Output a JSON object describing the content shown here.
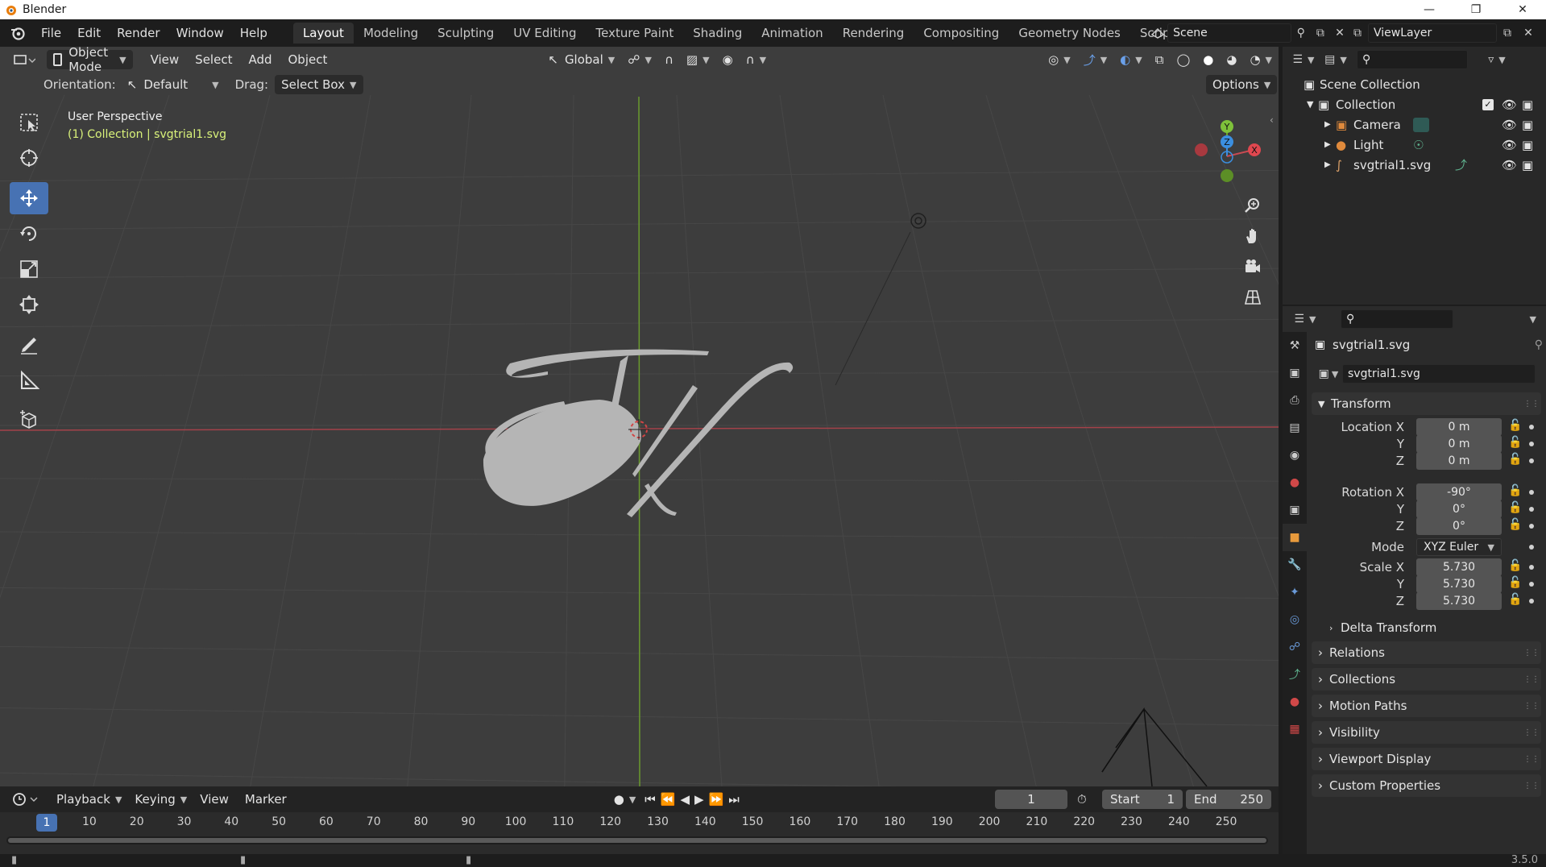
{
  "window": {
    "title": "Blender",
    "version": "3.5.0"
  },
  "menu": [
    "File",
    "Edit",
    "Render",
    "Window",
    "Help"
  ],
  "workspaces": [
    "Layout",
    "Modeling",
    "Sculpting",
    "UV Editing",
    "Texture Paint",
    "Shading",
    "Animation",
    "Rendering",
    "Compositing",
    "Geometry Nodes",
    "Scripting"
  ],
  "workspace_plus": "+",
  "scene": {
    "name": "Scene"
  },
  "view_layer": {
    "name": "ViewLayer"
  },
  "viewport_header": {
    "mode": "Object Mode",
    "menus": [
      "View",
      "Select",
      "Add",
      "Object"
    ],
    "transform_orientation": "Global"
  },
  "tool_header": {
    "orientation_label": "Orientation:",
    "orientation_value": "Default",
    "drag_label": "Drag:",
    "drag_value": "Select Box",
    "options": "Options"
  },
  "viewport_info": {
    "perspective": "User Perspective",
    "collection_line": "(1) Collection | svgtrial1.svg"
  },
  "gizmo_axes": {
    "y": "Y",
    "z": "Z",
    "x": "X"
  },
  "outliner": {
    "root": "Scene Collection",
    "collection": "Collection",
    "items": [
      "Camera",
      "Light",
      "svgtrial1.svg"
    ]
  },
  "properties": {
    "object_name": "svgtrial1.svg",
    "data_name": "svgtrial1.svg",
    "transform_panel": "Transform",
    "location": {
      "label": "Location X",
      "x": "0 m",
      "y": "0 m",
      "z": "0 m"
    },
    "rotation": {
      "label": "Rotation X",
      "x": "-90°",
      "y": "0°",
      "z": "0°"
    },
    "mode_label": "Mode",
    "mode_value": "XYZ Euler",
    "scale": {
      "label": "Scale X",
      "x": "5.730",
      "y": "5.730",
      "z": "5.730"
    },
    "axis_y": "Y",
    "axis_z": "Z",
    "delta_transform": "Delta Transform",
    "panels": [
      "Relations",
      "Collections",
      "Motion Paths",
      "Visibility",
      "Viewport Display",
      "Custom Properties"
    ]
  },
  "timeline": {
    "menus": [
      "Playback",
      "Keying",
      "View",
      "Marker"
    ],
    "current_frame": "1",
    "start_label": "Start",
    "start_value": "1",
    "end_label": "End",
    "end_value": "250",
    "ruler": [
      "1",
      "10",
      "20",
      "30",
      "40",
      "50",
      "60",
      "70",
      "80",
      "90",
      "100",
      "110",
      "120",
      "130",
      "140",
      "150",
      "160",
      "170",
      "180",
      "190",
      "200",
      "210",
      "220",
      "230",
      "240",
      "250"
    ]
  },
  "colors": {
    "accent": "#4772b3",
    "x_axis": "#e0474f",
    "y_axis": "#7ec13a",
    "z_axis": "#3b8fe0",
    "active_text": "#d9f27a"
  }
}
